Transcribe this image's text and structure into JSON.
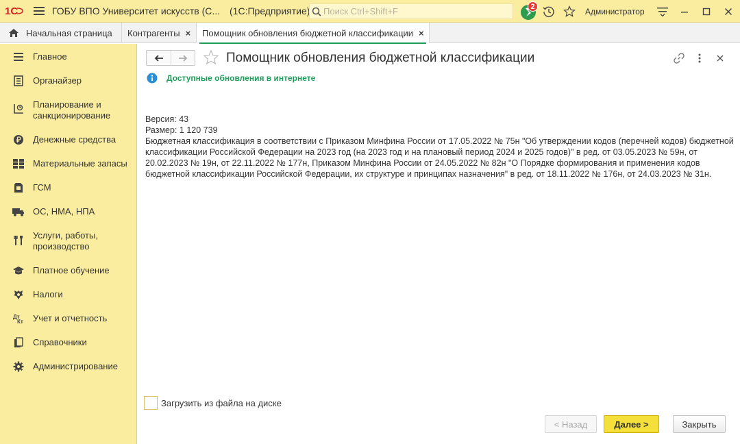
{
  "titlebar": {
    "logo_text": "1С",
    "app_title": "ГОБУ ВПО Университет искусств (С...",
    "app_subtitle": "(1С:Предприятие)",
    "search_placeholder": "Поиск Ctrl+Shift+F",
    "notifications_count": "2",
    "user": "Администратор"
  },
  "tabs": [
    {
      "label": "Начальная страница",
      "icon": "home-icon"
    },
    {
      "label": "Контрагенты",
      "close": "×"
    },
    {
      "label": "Помощник обновления бюджетной классификации",
      "close": "×",
      "active": true
    }
  ],
  "sidebar": {
    "items": [
      {
        "label": "Главное",
        "icon": "menu-lines-icon"
      },
      {
        "label": "Органайзер",
        "icon": "notepad-icon"
      },
      {
        "label": "Планирование и санкционирование",
        "icon": "planning-chart-icon"
      },
      {
        "label": "Денежные средства",
        "icon": "ruble-coin-icon"
      },
      {
        "label": "Материальные запасы",
        "icon": "grid-blocks-icon"
      },
      {
        "label": "ГСМ",
        "icon": "fuel-can-icon"
      },
      {
        "label": "ОС, НМА, НПА",
        "icon": "truck-icon"
      },
      {
        "label": "Услуги, работы, производство",
        "icon": "tools-icon"
      },
      {
        "label": "Платное обучение",
        "icon": "graduation-cap-icon"
      },
      {
        "label": "Налоги",
        "icon": "coat-of-arms-icon"
      },
      {
        "label": "Учет и отчетность",
        "icon": "accounting-icon"
      },
      {
        "label": "Справочники",
        "icon": "books-icon"
      },
      {
        "label": "Администрирование",
        "icon": "gear-icon"
      }
    ]
  },
  "form": {
    "title": "Помощник обновления бюджетной классификации",
    "info_text": "Доступные обновления в интернете",
    "version_line": "Версия: 43",
    "size_line": "Размер: 1 120 739",
    "description": "Бюджетная классификация в соответствии с Приказом Минфина России от 17.05.2022 № 75н \"Об утверждении кодов (перечней кодов) бюджетной классификации Российской Федерации на 2023 год (на 2023 год и на плановый период 2024 и 2025 годов)\" в ред. от 03.05.2023 № 59н, от 20.02.2023 № 19н, от 22.11.2022 № 177н, Приказом Минфина России от 24.05.2022 № 82н \"О Порядке формирования и применения кодов бюджетной классификации Российской Федерации, их структуре и принципах назначения\" в ред. от 18.11.2022 № 176н, от 24.03.2023 № 31н.",
    "checkbox_label": "Загрузить из файла на диске",
    "checkbox_checked": false,
    "buttons": {
      "back": "< Назад",
      "next": "Далее >",
      "close": "Закрыть"
    }
  },
  "colors": {
    "panel_yellow": "#fbeda0",
    "accent_green": "#1f9e5b",
    "primary_button": "#f5e03b",
    "badge_red": "#e53935"
  }
}
